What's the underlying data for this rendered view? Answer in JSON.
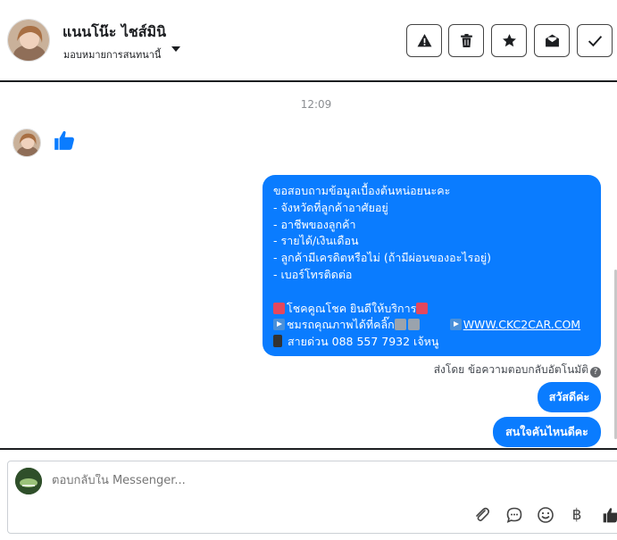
{
  "header": {
    "contact_name": "แนนโน๊ะ ไชส์มินิ",
    "assign_label": "มอบหมายการสนทนานี้",
    "buttons": [
      {
        "name": "spam-button",
        "icon": "alert-triangle-icon"
      },
      {
        "name": "delete-button",
        "icon": "trash-icon"
      },
      {
        "name": "star-button",
        "icon": "star-icon"
      },
      {
        "name": "mark-unread-button",
        "icon": "envelope-open-icon"
      },
      {
        "name": "mark-done-button",
        "icon": "check-icon"
      }
    ]
  },
  "chat": {
    "timestamp": "12:09",
    "incoming_like_icon": "thumbs-up-icon",
    "main_message": {
      "lines": [
        "ขอสอบถามข้อมูลเบื้องต้นหน่อยนะคะ",
        "- จังหวัดที่ลูกค้าอาศัยอยู่",
        "- อาชีพของลูกค้า",
        "- รายได้/เงินเดือน",
        "- ลูกค้ามีเครดิตหรือไม่ (ถ้ามีผ่อนของอะไรอยู่)",
        "- เบอร์โทรติดต่อ"
      ],
      "promo_1": "โชคคูณโชค ยินดีให้บริการ",
      "promo_2": "ชมรถคุณภาพได้ที่คลิ๊ก",
      "website": "WWW.CKC2CAR.COM",
      "hotline": "สายด่วน 088 557 7932 เจ้หนู"
    },
    "sent_by": "ส่งโดย ข้อความตอบกลับอัตโนมัติ",
    "quick_replies": [
      "สวัสดีค่ะ",
      "สนใจคันไหนดีคะ"
    ]
  },
  "composer": {
    "placeholder": "ตอบกลับใน Messenger...",
    "tools": [
      "paperclip-icon",
      "chat-bubble-icon",
      "emoji-icon",
      "baht-icon",
      "thumbs-up-icon"
    ],
    "baht_symbol": "฿"
  },
  "colors": {
    "bubble_blue": "#0a7cff",
    "header_border": "#1c1e21",
    "timestamp_gray": "#8a8d91"
  }
}
